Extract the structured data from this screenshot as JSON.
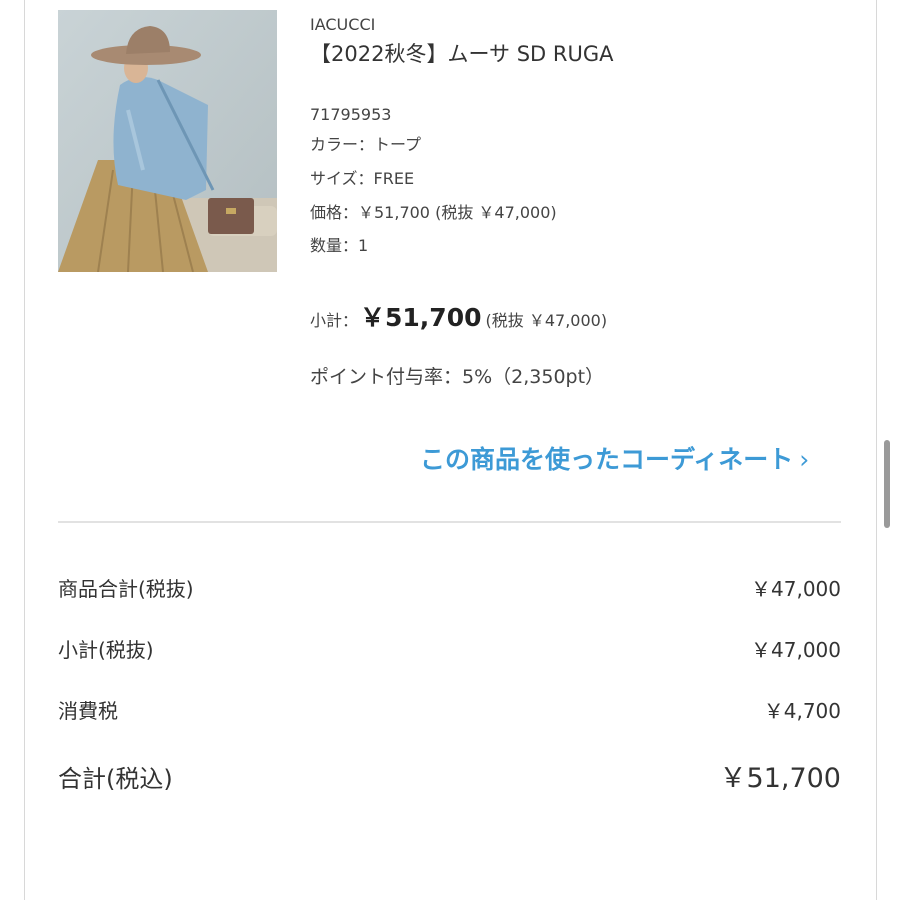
{
  "product": {
    "brand": "IACUCCI",
    "name": "【2022秋冬】ムーサ SD RUGA",
    "code": "71795953",
    "color": "カラー：トープ",
    "size": "サイズ：FREE",
    "price": "価格：￥51,700 (税抜 ￥47,000)",
    "quantity": "数量：1",
    "subtotal_label": "小計：",
    "subtotal_price": "￥51,700",
    "subtotal_tax": "(税抜 ￥47,000)",
    "points": "ポイント付与率：5%（2,350pt）",
    "coordinate_link": "この商品を使ったコーディネート",
    "coordinate_link_icon": "chevron-right-icon"
  },
  "summary": {
    "rows": [
      {
        "label": "商品合計(税抜)",
        "value": "￥47,000"
      },
      {
        "label": "小計(税抜)",
        "value": "￥47,000"
      },
      {
        "label": "消費税",
        "value": "￥4,700"
      },
      {
        "label": "合計(税込)",
        "value": "￥51,700"
      }
    ]
  },
  "colors": {
    "link": "#3d9ad6",
    "divider": "#e2e2e2"
  }
}
